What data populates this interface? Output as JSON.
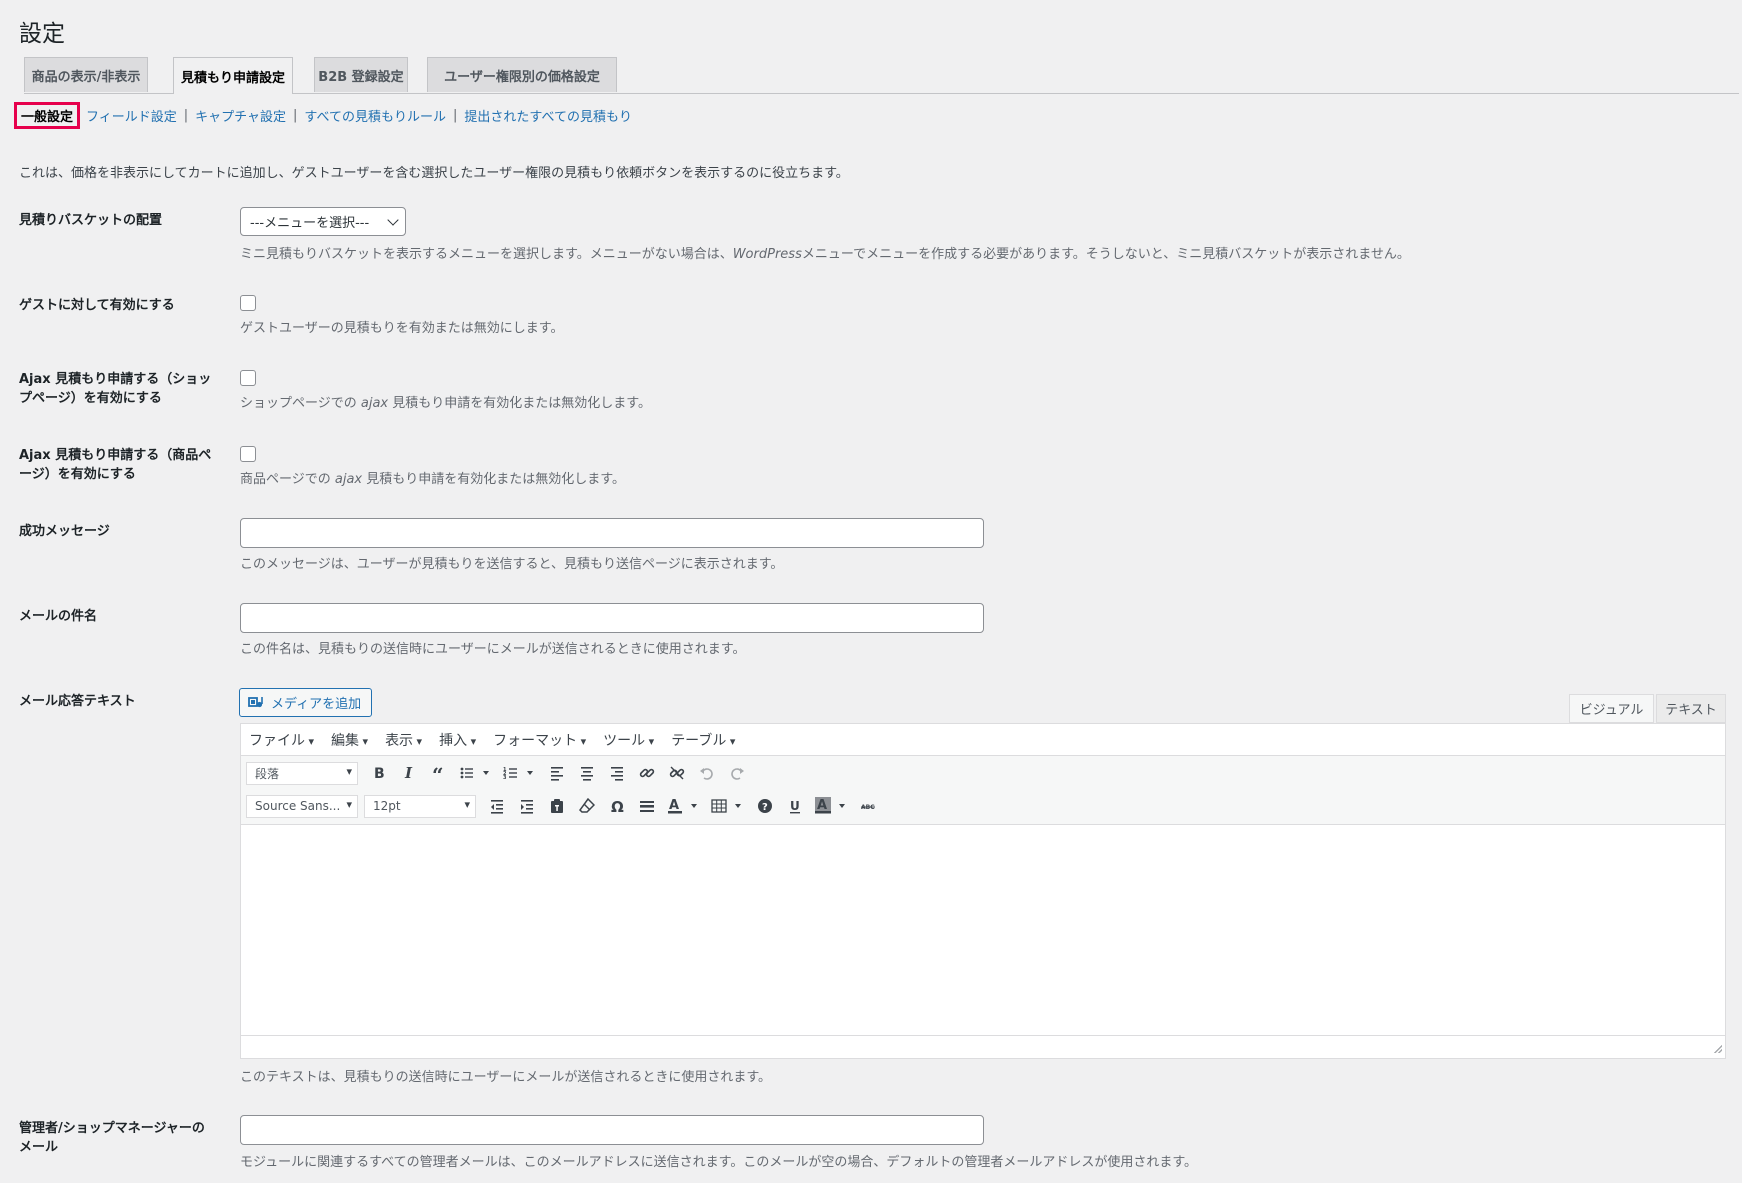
{
  "page": {
    "title": "設定"
  },
  "tabs": [
    {
      "label": "商品の表示/非表示",
      "active": false
    },
    {
      "label": "見積もり申請設定",
      "active": true
    },
    {
      "label": "B2B 登録設定",
      "active": false
    },
    {
      "label": "ユーザー権限別の価格設定",
      "active": false
    }
  ],
  "subnav": {
    "current": "一般設定",
    "links": [
      "フィールド設定",
      "キャプチャ設定",
      "すべての見積もりルール",
      "提出されたすべての見積もり"
    ],
    "separator": "|"
  },
  "intro": "これは、価格を非表示にしてカートに追加し、ゲストユーザーを含む選択したユーザー権限の見積もり依頼ボタンを表示するのに役立ちます。",
  "fields": {
    "basket": {
      "label": "見積りバスケットの配置",
      "select_value": "---メニューを選択---",
      "desc_a": "ミニ見積もりバスケットを表示するメニューを選択します。メニューがない場合は、",
      "desc_em": "WordPress",
      "desc_b": "メニューでメニューを作成する必要があります。そうしないと、ミニ見積バスケットが表示されません。"
    },
    "guest": {
      "label": "ゲストに対して有効にする",
      "checked": false,
      "desc": "ゲストユーザーの見積もりを有効または無効にします。"
    },
    "ajax_shop": {
      "label": "Ajax 見積もり申請する（ショップページ）を有効にする",
      "checked": false,
      "desc_a": "ショップページでの ",
      "desc_em": "ajax",
      "desc_b": " 見積もり申請を有効化または無効化します。"
    },
    "ajax_product": {
      "label": "Ajax 見積もり申請する（商品ページ）を有効にする",
      "checked": false,
      "desc_a": "商品ページでの ",
      "desc_em": "ajax",
      "desc_b": " 見積もり申請を有効化または無効化します。"
    },
    "success_msg": {
      "label": "成功メッセージ",
      "value": "",
      "desc": "このメッセージは、ユーザーが見積もりを送信すると、見積もり送信ページに表示されます。"
    },
    "mail_subject": {
      "label": "メールの件名",
      "value": "",
      "desc": "この件名は、見積もりの送信時にユーザーにメールが送信されるときに使用されます。"
    },
    "mail_body": {
      "label": "メール応答テキスト",
      "desc": "このテキストは、見積もりの送信時にユーザーにメールが送信されるときに使用されます。"
    },
    "admin_email": {
      "label": "管理者/ショップマネージャーのメール",
      "value": "",
      "desc": "モジュールに関連するすべての管理者メールは、このメールアドレスに送信されます。このメールが空の場合、デフォルトの管理者メールアドレスが使用されます。"
    }
  },
  "editor": {
    "add_media": "メディアを追加",
    "tab_visual": "ビジュアル",
    "tab_text": "テキスト",
    "menus": [
      "ファイル",
      "編集",
      "表示",
      "挿入",
      "フォーマット",
      "ツール",
      "テーブル"
    ],
    "format_select": "段落",
    "font_select": "Source Sans...",
    "size_select": "12pt",
    "icons_row1": [
      "bold-icon",
      "italic-icon",
      "blockquote-icon",
      "bullet-list-icon",
      "numbered-list-icon",
      "align-left-icon",
      "align-center-icon",
      "align-right-icon",
      "link-icon",
      "unlink-icon",
      "undo-icon",
      "redo-icon"
    ],
    "icons_row2": [
      "outdent-icon",
      "indent-icon",
      "paste-text-icon",
      "clear-formatting-icon",
      "special-character-icon",
      "horizontal-line-icon",
      "text-color-icon",
      "table-icon",
      "help-icon",
      "underline-icon",
      "background-color-icon",
      "strikethrough-icon"
    ]
  },
  "colors": {
    "link": "#2271b1",
    "highlight_border": "#e6004c",
    "background": "#f0f0f1"
  }
}
